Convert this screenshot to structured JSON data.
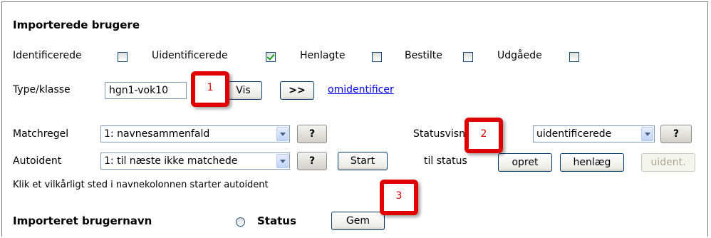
{
  "title": "Importerede brugere",
  "filters": [
    {
      "label": "Identificerede",
      "checked": false
    },
    {
      "label": "Uidentificerede",
      "checked": true
    },
    {
      "label": "Henlagte",
      "checked": false
    },
    {
      "label": "Bestilte",
      "checked": false
    },
    {
      "label": "Udgåede",
      "checked": false
    }
  ],
  "type_klasse": {
    "label": "Type/klasse",
    "value": "hgn1-vok10",
    "vis_label": "Vis",
    "next_label": ">>",
    "link_label": "omidentificer"
  },
  "matchregel": {
    "label": "Matchregel",
    "value": "1: navnesammenfald",
    "help_label": "?"
  },
  "autoident": {
    "label": "Autoident",
    "value": "1: til næste ikke matchede",
    "help_label": "?",
    "start_label": "Start"
  },
  "statusvisning": {
    "label": "Statusvisning",
    "value": "uidentificerede",
    "help_label": "?"
  },
  "til_status": {
    "label": "til status",
    "buttons": [
      "opret",
      "henlæg",
      "uident."
    ]
  },
  "hint": "Klik et vilkårligt sted i navnekolonnen starter autoident",
  "bottom": {
    "name_label": "Importeret brugernavn",
    "status_label": "Status",
    "save_label": "Gem"
  },
  "callouts": [
    "1",
    "2",
    "3"
  ],
  "colors": {
    "callout": "#e00000",
    "link": "#0000ee"
  }
}
